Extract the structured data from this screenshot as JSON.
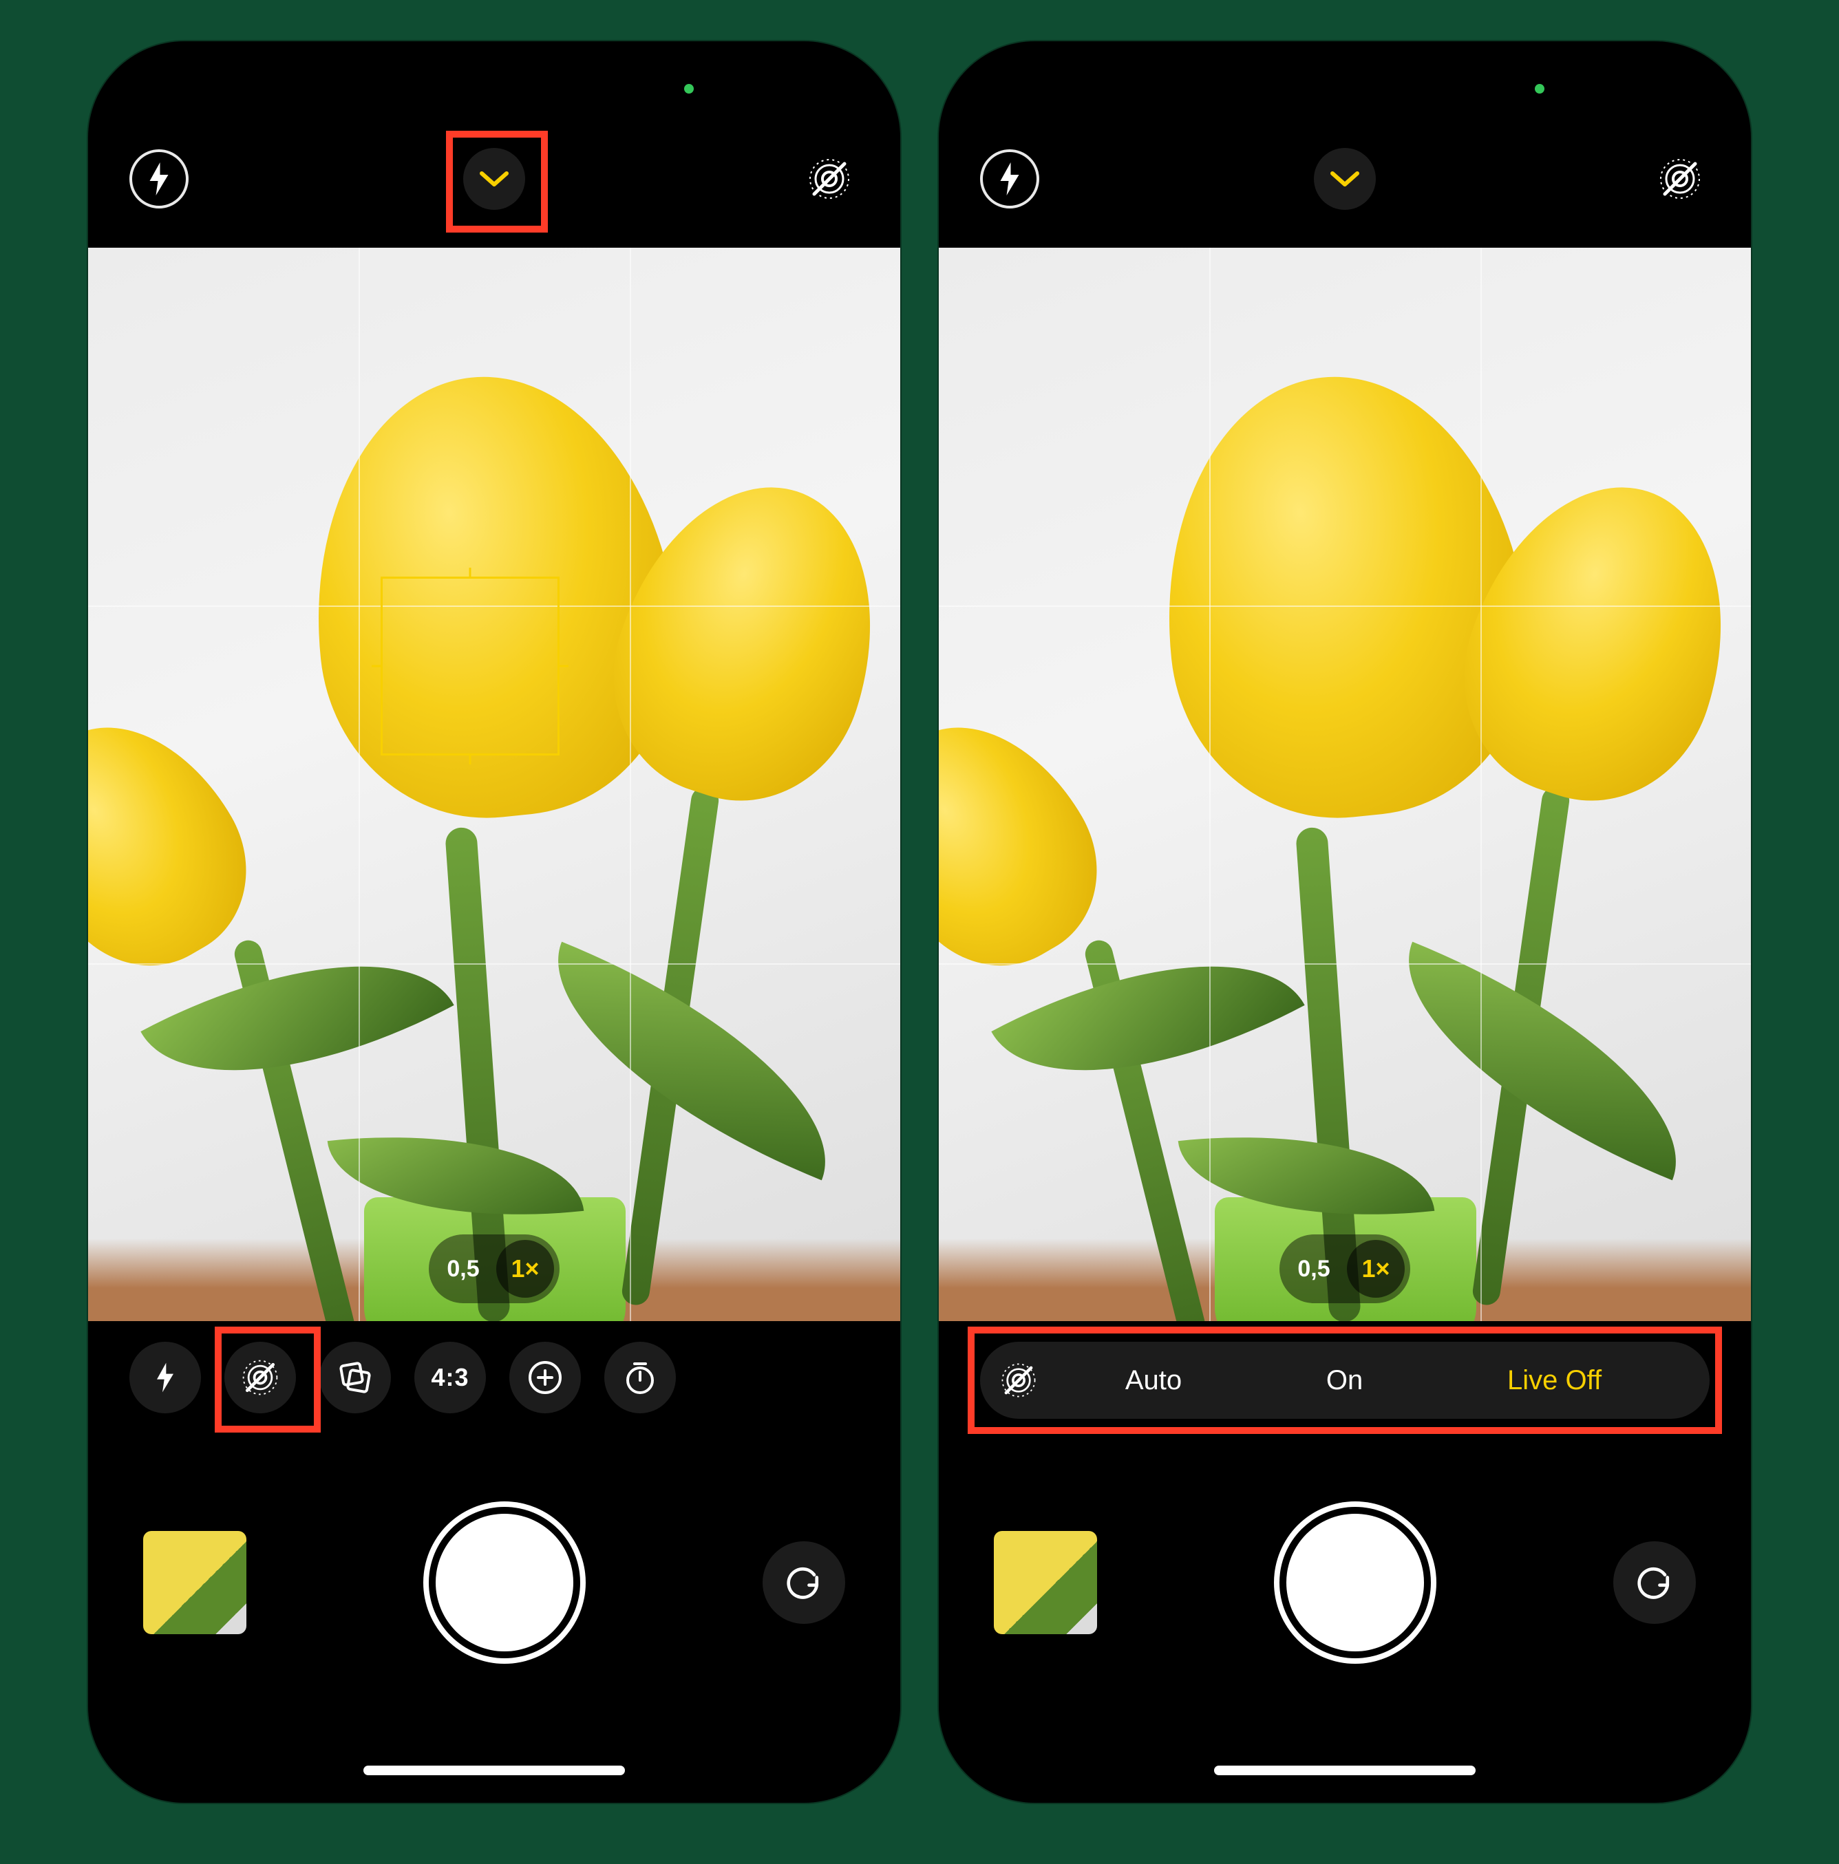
{
  "left": {
    "top": {
      "flash_icon": "flash-icon",
      "chevron_icon": "chevron-down-icon",
      "live_icon": "live-off-icon"
    },
    "zoom": {
      "alt_label": "0,5",
      "active_label": "1×"
    },
    "tools": {
      "flash_icon": "flash-icon",
      "live_icon": "live-off-icon",
      "filter_icon": "photographic-styles-icon",
      "aspect_label": "4:3",
      "exposure_icon": "exposure-icon",
      "timer_icon": "timer-icon"
    },
    "bottom": {
      "thumbnail": "last-photo-thumbnail",
      "shutter": "shutter-button",
      "flip": "camera-flip-icon"
    }
  },
  "right": {
    "top": {
      "flash_icon": "flash-icon",
      "chevron_icon": "chevron-down-icon",
      "live_icon": "live-off-icon"
    },
    "zoom": {
      "alt_label": "0,5",
      "active_label": "1×"
    },
    "live_options": {
      "icon": "live-off-icon",
      "auto": "Auto",
      "on": "On",
      "off": "Live Off"
    },
    "bottom": {
      "thumbnail": "last-photo-thumbnail",
      "shutter": "shutter-button",
      "flip": "camera-flip-icon"
    }
  },
  "colors": {
    "accent": "#f8d000",
    "highlight": "#ff3c28"
  }
}
